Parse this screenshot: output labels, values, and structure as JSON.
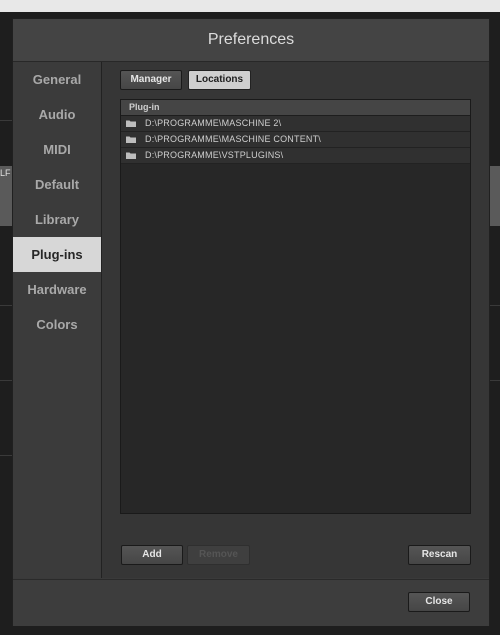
{
  "background": {
    "fragment_text": "LF"
  },
  "dialog": {
    "title": "Preferences"
  },
  "sidebar": {
    "items": [
      {
        "label": "General"
      },
      {
        "label": "Audio"
      },
      {
        "label": "MIDI"
      },
      {
        "label": "Default"
      },
      {
        "label": "Library"
      },
      {
        "label": "Plug-ins",
        "active": true
      },
      {
        "label": "Hardware"
      },
      {
        "label": "Colors"
      }
    ]
  },
  "tabs": {
    "manager": "Manager",
    "locations": "Locations",
    "selected": "Locations"
  },
  "table": {
    "header": "Plug-in",
    "rows": [
      {
        "icon": "folder-icon",
        "path": "D:\\PROGRAMME\\MASCHINE 2\\"
      },
      {
        "icon": "folder-icon",
        "path": "D:\\PROGRAMME\\MASCHINE CONTENT\\"
      },
      {
        "icon": "folder-icon",
        "path": "D:\\PROGRAMME\\VSTPLUGINS\\"
      }
    ]
  },
  "buttons": {
    "add": "Add",
    "remove": "Remove",
    "rescan": "Rescan",
    "close": "Close"
  },
  "colors": {
    "active_nav": "#d7d7d7",
    "dialog_bg": "#3a3a3a",
    "table_bg": "#272727"
  }
}
